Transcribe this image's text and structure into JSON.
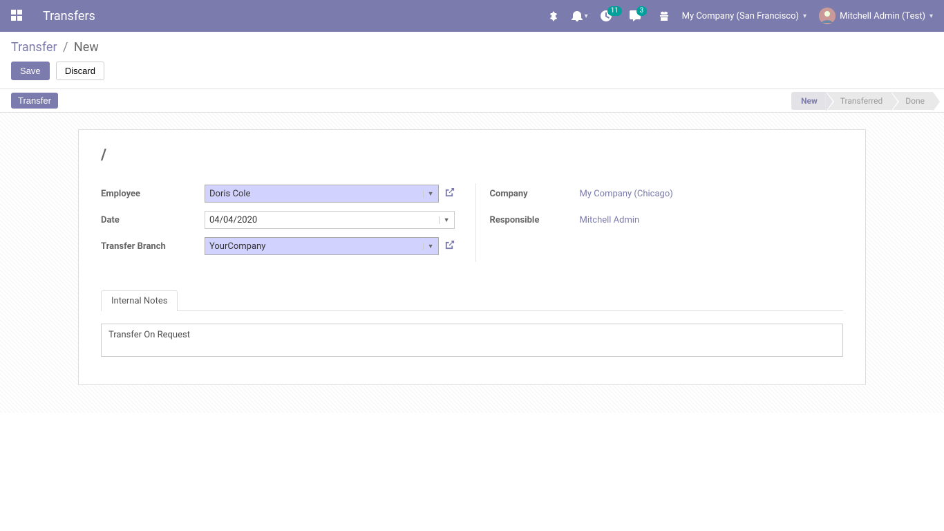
{
  "header": {
    "app_title": "Transfers",
    "badge1": "11",
    "badge2": "3",
    "company": "My Company (San Francisco)",
    "user": "Mitchell Admin (Test)"
  },
  "control": {
    "breadcrumb_root": "Transfer",
    "breadcrumb_current": "New",
    "btn_save": "Save",
    "btn_discard": "Discard"
  },
  "statusbar": {
    "btn_transfer": "Transfer",
    "steps": [
      "New",
      "Transferred",
      "Done"
    ],
    "active": "New"
  },
  "form": {
    "title": "/",
    "left": {
      "employee_label": "Employee",
      "employee_value": "Doris Cole",
      "date_label": "Date",
      "date_value": "04/04/2020",
      "branch_label": "Transfer Branch",
      "branch_value": "YourCompany"
    },
    "right": {
      "company_label": "Company",
      "company_value": "My Company (Chicago)",
      "responsible_label": "Responsible",
      "responsible_value": "Mitchell Admin"
    },
    "tabs": {
      "internal_notes": "Internal Notes"
    },
    "notes_value": "Transfer On Request"
  }
}
